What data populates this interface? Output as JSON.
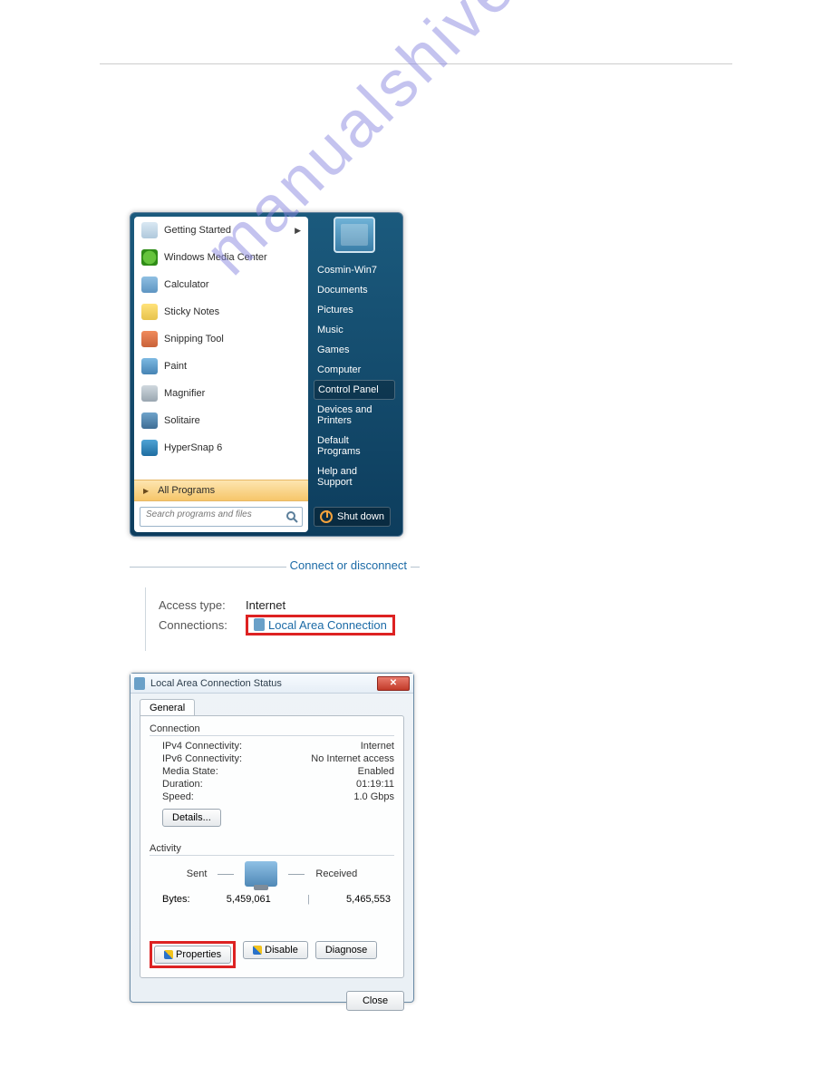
{
  "watermark": "manualshive.com",
  "start_menu": {
    "programs": [
      {
        "label": "Getting Started",
        "has_submenu": true
      },
      {
        "label": "Windows Media Center"
      },
      {
        "label": "Calculator"
      },
      {
        "label": "Sticky Notes"
      },
      {
        "label": "Snipping Tool"
      },
      {
        "label": "Paint"
      },
      {
        "label": "Magnifier"
      },
      {
        "label": "Solitaire"
      },
      {
        "label": "HyperSnap 6"
      }
    ],
    "all_programs": "All Programs",
    "search_placeholder": "Search programs and files",
    "right": {
      "user": "Cosmin-Win7",
      "items": [
        "Documents",
        "Pictures",
        "Music",
        "Games",
        "Computer",
        "Control Panel",
        "Devices and Printers",
        "Default Programs",
        "Help and Support"
      ],
      "selected": "Control Panel"
    },
    "shutdown": "Shut down"
  },
  "network": {
    "heading": "Connect or disconnect",
    "access_label": "Access type:",
    "access_value": "Internet",
    "conn_label": "Connections:",
    "conn_link": "Local Area Connection"
  },
  "status": {
    "title": "Local Area Connection Status",
    "tab": "General",
    "connection_title": "Connection",
    "fields": {
      "ipv4_label": "IPv4 Connectivity:",
      "ipv4_value": "Internet",
      "ipv6_label": "IPv6 Connectivity:",
      "ipv6_value": "No Internet access",
      "media_label": "Media State:",
      "media_value": "Enabled",
      "duration_label": "Duration:",
      "duration_value": "01:19:11",
      "speed_label": "Speed:",
      "speed_value": "1.0 Gbps"
    },
    "details": "Details...",
    "activity_title": "Activity",
    "sent": "Sent",
    "received": "Received",
    "bytes_label": "Bytes:",
    "bytes_sent": "5,459,061",
    "bytes_recv": "5,465,553",
    "properties": "Properties",
    "disable": "Disable",
    "diagnose": "Diagnose",
    "close": "Close"
  }
}
